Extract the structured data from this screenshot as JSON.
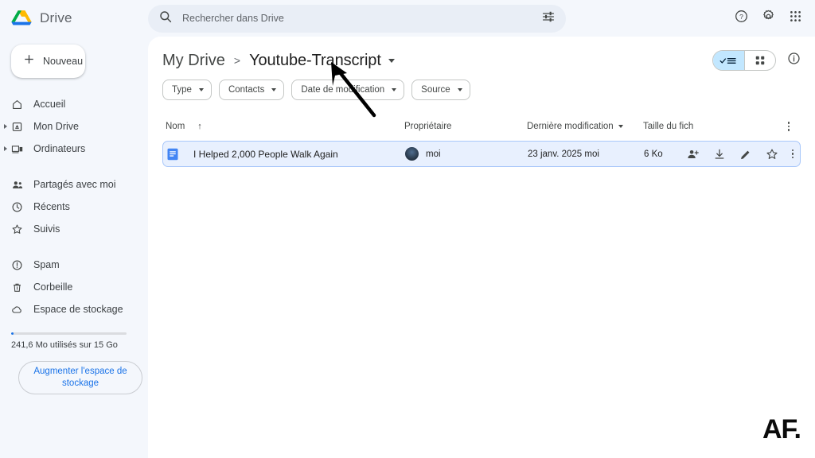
{
  "app": {
    "brand_name": "Drive",
    "logo_colors": {
      "blue": "#1a73e8",
      "green": "#00ac47",
      "yellow": "#ffba00",
      "red": "#ea4335"
    },
    "accent": "#1a73e8",
    "selection_bg": "#e8f0fe",
    "selection_border": "#a8c7fa",
    "watermark": "AF."
  },
  "search": {
    "placeholder": "Rechercher dans Drive",
    "value": "",
    "search_icon": "search-icon",
    "tune_icon": "tune-icon"
  },
  "topbar_right": [
    {
      "name": "help-icon",
      "label": "?"
    },
    {
      "name": "settings-gear-icon",
      "label": ""
    },
    {
      "name": "apps-grid-icon",
      "label": ""
    }
  ],
  "sidebar": {
    "new_button": {
      "label": "Nouveau",
      "icon": "plus-icon"
    },
    "groups": [
      {
        "items": [
          {
            "label": "Accueil",
            "icon": "home-icon",
            "expandable": false
          },
          {
            "label": "Mon Drive",
            "icon": "drive-folder-icon",
            "expandable": true
          },
          {
            "label": "Ordinateurs",
            "icon": "computer-icon",
            "expandable": true
          }
        ]
      },
      {
        "items": [
          {
            "label": "Partagés avec moi",
            "icon": "people-shared-icon",
            "expandable": false
          },
          {
            "label": "Récents",
            "icon": "clock-icon",
            "expandable": false
          },
          {
            "label": "Suivis",
            "icon": "star-icon",
            "expandable": false
          }
        ]
      },
      {
        "items": [
          {
            "label": "Spam",
            "icon": "alert-circle-icon",
            "expandable": false
          },
          {
            "label": "Corbeille",
            "icon": "trash-icon",
            "expandable": false
          },
          {
            "label": "Espace de stockage",
            "icon": "cloud-icon",
            "expandable": false
          }
        ]
      }
    ],
    "storage": {
      "text": "241,6 Mo utilisés sur 15 Go",
      "used_percent": 1.6,
      "upgrade_label": "Augmenter l'espace de stockage"
    }
  },
  "breadcrumb": {
    "root": "My Drive",
    "separator": ">",
    "current": "Youtube-Transcript",
    "caret_icon": "chevron-down-icon"
  },
  "view_toggle": {
    "list_label": "",
    "grid_label": "",
    "active": "list",
    "list_icon": "list-view-icon",
    "grid_icon": "grid-view-icon",
    "info_icon": "info-icon"
  },
  "filters": [
    {
      "label": "Type",
      "name": "filter-chip-type"
    },
    {
      "label": "Contacts",
      "name": "filter-chip-contacts"
    },
    {
      "label": "Date de modification",
      "name": "filter-chip-date"
    },
    {
      "label": "Source",
      "name": "filter-chip-source"
    }
  ],
  "table": {
    "headers": {
      "name": "Nom",
      "name_sort": "↑",
      "owner": "Propriétaire",
      "modified": "Dernière modification",
      "size": "Taille du fich",
      "more_icon": "more-vertical-icon"
    },
    "rows": [
      {
        "file_icon": "google-docs-icon",
        "name": "I Helped 2,000 People Walk Again",
        "owner": "moi",
        "owner_avatar": "user-avatar",
        "modified": "23 janv. 2025 moi",
        "size": "6 Ko",
        "selected": true,
        "actions": [
          {
            "name": "share-person-icon"
          },
          {
            "name": "download-icon"
          },
          {
            "name": "edit-pencil-icon"
          },
          {
            "name": "star-outline-icon"
          },
          {
            "name": "more-vertical-icon"
          }
        ]
      }
    ]
  }
}
